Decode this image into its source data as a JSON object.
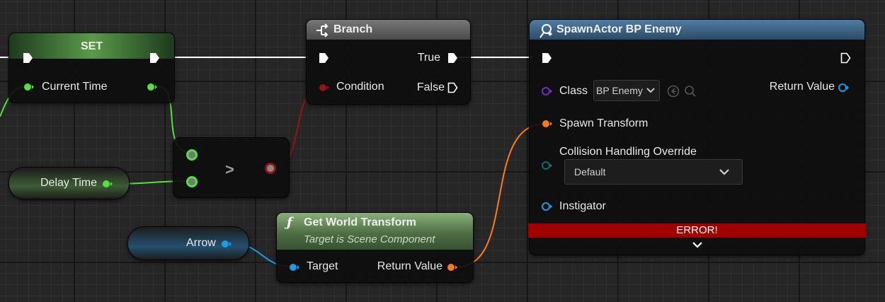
{
  "set_node": {
    "title": "SET",
    "var_label": "Current Time"
  },
  "delay_node": {
    "label": "Delay Time"
  },
  "compare_node": {
    "operator": ">"
  },
  "branch_node": {
    "title": "Branch",
    "condition_label": "Condition",
    "true_label": "True",
    "false_label": "False"
  },
  "arrow_node": {
    "label": "Arrow"
  },
  "transform_node": {
    "title": "Get World Transform",
    "subtitle": "Target is Scene Component",
    "target_label": "Target",
    "return_label": "Return Value"
  },
  "spawn_node": {
    "title": "SpawnActor BP Enemy",
    "class_label": "Class",
    "class_value": "BP Enemy",
    "return_label": "Return Value",
    "spawn_transform_label": "Spawn Transform",
    "collision_label": "Collision Handling Override",
    "collision_value": "Default",
    "instigator_label": "Instigator",
    "error_text": "ERROR!"
  },
  "colors": {
    "exec": "#ffffff",
    "float": "#52e23a",
    "bool": "#951414",
    "transform": "#ff7a17",
    "object": "#1b9be8",
    "class": "#7a2ad0",
    "enum": "#136a6a",
    "error": "#a10000"
  },
  "icons": [
    "branch-icon",
    "function-icon",
    "spawn-actor-icon",
    "dropdown-chevron-icon",
    "browse-back-icon",
    "search-icon",
    "expand-chevron-icon"
  ]
}
